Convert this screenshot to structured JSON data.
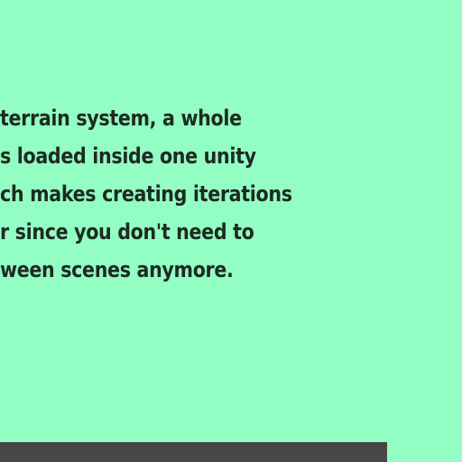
{
  "paragraph": {
    "lines": [
      "terrain system, a whole",
      "s loaded inside one unity",
      "ch makes creating iterations",
      "r since you don't need to",
      "ween scenes anymore."
    ]
  },
  "colors": {
    "background": "#93fec3",
    "text": "#1d2a22",
    "bottom_bar": "#474747"
  }
}
